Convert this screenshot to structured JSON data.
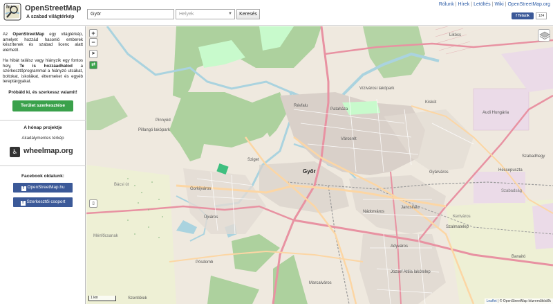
{
  "header": {
    "brand": "OpenStreetMap",
    "tagline": "A szabad világtérkép",
    "logo_text": "hu",
    "search_value": "Győr",
    "place_placeholder": "Helyek",
    "search_button": "Keresés",
    "nav": [
      "Rólunk",
      "Hírek",
      "Letöltés",
      "Wiki",
      "OpenStreetMap.org"
    ],
    "fb_like": "Tetszik",
    "fb_count": "124"
  },
  "sidebar": {
    "intro_1": "Az OpenStreetMap egy világtérkép, amelyet hozzád hasonló emberek készítenek és szabad licenc alatt elérhető.",
    "intro_2": "Ha hibát találsz vagy hiányzik egy fontos hely, Te is hozzáadhatod a szerkesztőprogrammal a hiányzó utcákat, boltokat, iskolákat, éttermeket és egyéb tereptárgyakat.",
    "cta": "Próbáld ki, és szerkessz valamit!",
    "edit_button": "Terület szerkesztése",
    "project_title": "A hónap projektje",
    "project_sub": "Akadálymentes térkép",
    "wheelmap": "wheelmap.org",
    "facebook_title": "Facebook oldalunk:",
    "fb_button_1": "OpenStreetMap.hu",
    "fb_button_2": "Szerkesztői csoport"
  },
  "map": {
    "zoom_in": "+",
    "zoom_out": "−",
    "scale": "1 km",
    "attribution_leaflet": "Leaflet",
    "attribution_rest": "| © OpenStreetMap közreműködők",
    "labels_big": [
      "Győr"
    ],
    "labels": [
      "Révfalu",
      "Pataháza",
      "Vízivárosi lakópark",
      "Kiskút",
      "Audi Hungária",
      "Pinnyéd",
      "Pillangó lakópark",
      "Sziget",
      "Gorkijváros",
      "Újváros",
      "Nádorváros",
      "Jancsifalu",
      "Hecsepuszta",
      "Gyárváros",
      "Szabadhegy",
      "Adyváros",
      "József Attila lakótelep",
      "Marcalváros",
      "Pósdomb",
      "Szentlélek",
      "Városrét",
      "Bácsi út",
      "Szabadság",
      "Kertváros",
      "Ménfőcsanak",
      "Likócs",
      "Szalmatelep",
      "Banaitó"
    ]
  },
  "colors": {
    "accent_green": "#3aa14b",
    "facebook_blue": "#3b5998",
    "link_blue": "#2a5aa5",
    "map_bg": "#efe9df",
    "forest": "#add19e",
    "water": "#aad3df",
    "motorway": "#e892a2",
    "primary": "#fcd6a4",
    "industrial": "#ebdbe8"
  }
}
